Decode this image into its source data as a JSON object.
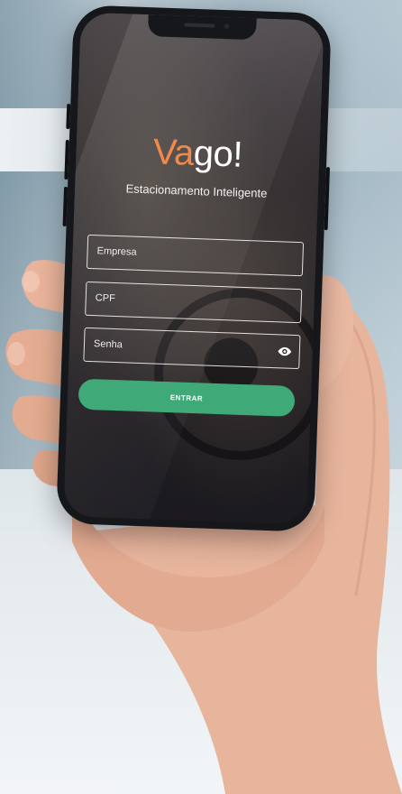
{
  "app": {
    "logo_part1": "Va",
    "logo_part2": "go!",
    "tagline": "Estacionamento Inteligente"
  },
  "form": {
    "company_label": "Empresa",
    "cpf_label": "CPF",
    "password_label": "Senha",
    "submit_label": "ENTRAR"
  },
  "icons": {
    "password_toggle": "eye-icon"
  },
  "colors": {
    "brand_orange": "#f08a4b",
    "button_green": "#3fa978",
    "field_border": "#ffffff"
  }
}
